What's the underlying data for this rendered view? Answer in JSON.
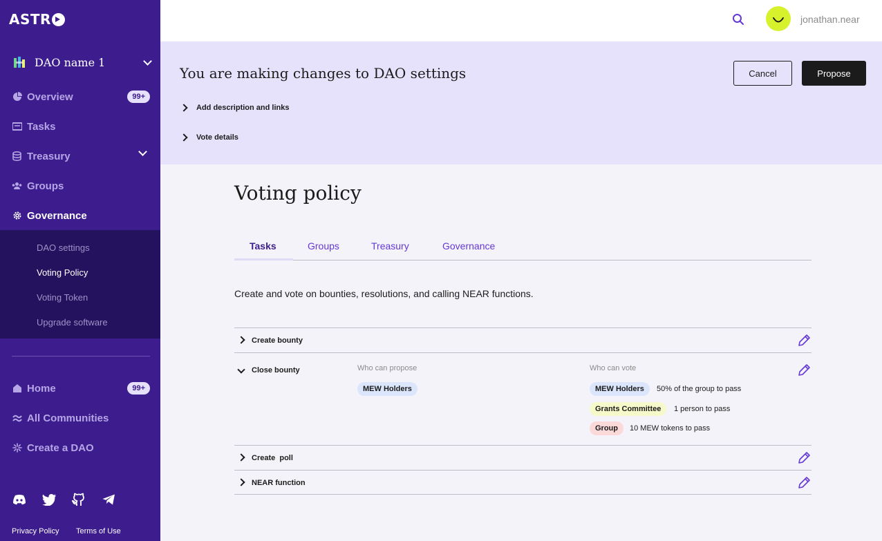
{
  "sidebar": {
    "logo": "ASTR",
    "dao_name": "DAO name 1",
    "nav": [
      {
        "label": "Overview",
        "badge": "99+"
      },
      {
        "label": "Tasks"
      },
      {
        "label": "Treasury"
      },
      {
        "label": "Groups"
      },
      {
        "label": "Governance"
      }
    ],
    "submenu": [
      "DAO settings",
      "Voting Policy",
      "Voting Token",
      "Upgrade software"
    ],
    "bottom_nav": [
      {
        "label": "Home",
        "badge": "99+"
      },
      {
        "label": "All Communities"
      },
      {
        "label": "Create a DAO"
      }
    ],
    "social_icons": [
      "discord-icon",
      "twitter-icon",
      "github-icon",
      "telegram-icon"
    ],
    "footer": {
      "privacy": "Privacy Policy",
      "terms": "Terms of Use"
    }
  },
  "header": {
    "username": "jonathan.near"
  },
  "banner": {
    "title": "You are making changes to DAO settings",
    "expanders": [
      "Add description and links",
      "Vote details"
    ],
    "cancel_label": "Cancel",
    "propose_label": "Propose"
  },
  "main": {
    "title": "Voting policy",
    "tabs": [
      "Tasks",
      "Groups",
      "Treasury",
      "Governance"
    ],
    "description": "Create and vote on bounties, resolutions, and calling NEAR functions.",
    "rows": [
      {
        "label": "Create bounty"
      },
      {
        "label": "Close bounty",
        "propose_head": "Who can propose",
        "vote_head": "Who can vote",
        "proposers": [
          "MEW Holders"
        ],
        "voters": [
          {
            "group": "MEW Holders",
            "rule": "50% of the group to pass"
          },
          {
            "group": "Grants Committee",
            "rule": "1 person to pass"
          },
          {
            "group": "Group",
            "rule": "10 MEW tokens to pass"
          }
        ]
      },
      {
        "label": "Create  poll"
      },
      {
        "label": "NEAR function"
      }
    ]
  },
  "colors": {
    "sidebar_bg": "#3d1c8e",
    "submenu_bg": "#25125e",
    "banner_bg": "#e7e2fb",
    "accent": "#6437d8",
    "avatar": "#d7f22c"
  }
}
